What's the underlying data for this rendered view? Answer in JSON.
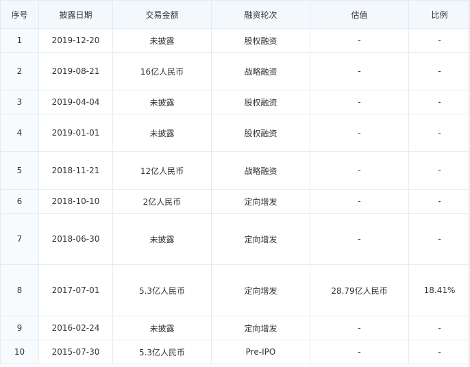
{
  "table": {
    "headers": [
      "序号",
      "披露日期",
      "交易金额",
      "融资轮次",
      "估值",
      "比例"
    ],
    "rows": [
      {
        "no": "1",
        "date": "2019-12-20",
        "amount": "未披露",
        "round": "股权融资",
        "valuation": "-",
        "ratio": "-"
      },
      {
        "no": "2",
        "date": "2019-08-21",
        "amount": "16亿人民币",
        "round": "战略融资",
        "valuation": "-",
        "ratio": "-"
      },
      {
        "no": "3",
        "date": "2019-04-04",
        "amount": "未披露",
        "round": "股权融资",
        "valuation": "-",
        "ratio": "-"
      },
      {
        "no": "4",
        "date": "2019-01-01",
        "amount": "未披露",
        "round": "股权融资",
        "valuation": "-",
        "ratio": "-"
      },
      {
        "no": "5",
        "date": "2018-11-21",
        "amount": "12亿人民币",
        "round": "战略融资",
        "valuation": "-",
        "ratio": "-"
      },
      {
        "no": "6",
        "date": "2018-10-10",
        "amount": "2亿人民币",
        "round": "定向增发",
        "valuation": "-",
        "ratio": "-"
      },
      {
        "no": "7",
        "date": "2018-06-30",
        "amount": "未披露",
        "round": "定向增发",
        "valuation": "-",
        "ratio": "-"
      },
      {
        "no": "8",
        "date": "2017-07-01",
        "amount": "5.3亿人民币",
        "round": "定向增发",
        "valuation": "28.79亿人民币",
        "ratio": "18.41%"
      },
      {
        "no": "9",
        "date": "2016-02-24",
        "amount": "未披露",
        "round": "定向增发",
        "valuation": "-",
        "ratio": "-"
      },
      {
        "no": "10",
        "date": "2015-07-30",
        "amount": "5.3亿人民币",
        "round": "Pre-IPO",
        "valuation": "-",
        "ratio": "-"
      }
    ]
  }
}
